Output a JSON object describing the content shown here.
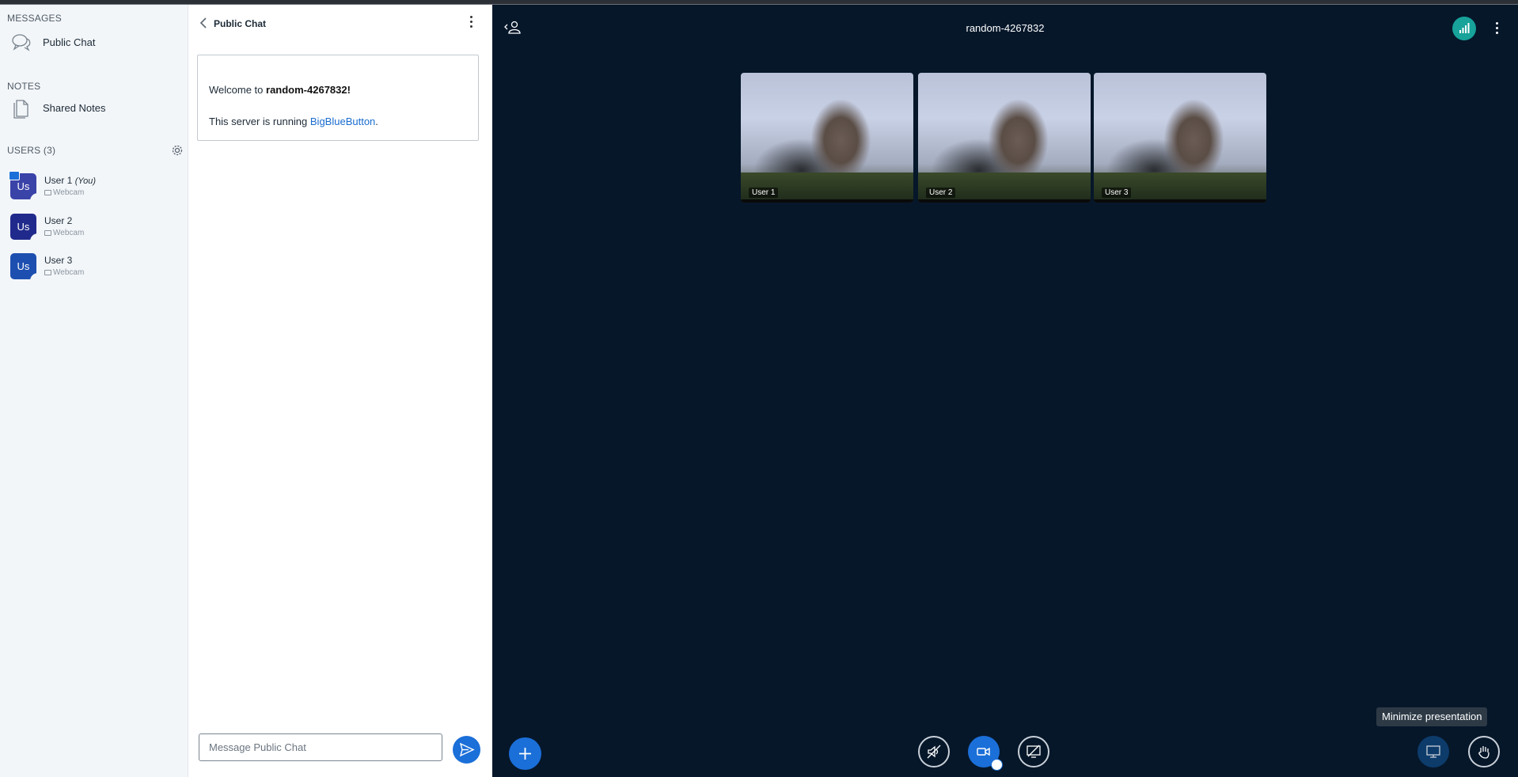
{
  "sidebar": {
    "messages_title": "MESSAGES",
    "public_chat_label": "Public Chat",
    "notes_title": "NOTES",
    "shared_notes_label": "Shared Notes",
    "users_title": "USERS (3)",
    "users": [
      {
        "initials": "Us",
        "name": "User 1",
        "you": "(You)",
        "status": "Webcam",
        "color": "#3a43a8"
      },
      {
        "initials": "Us",
        "name": "User 2",
        "you": "",
        "status": "Webcam",
        "color": "#202a8c"
      },
      {
        "initials": "Us",
        "name": "User 3",
        "you": "",
        "status": "Webcam",
        "color": "#1d4fb0"
      }
    ]
  },
  "chat": {
    "title": "Public Chat",
    "welcome_prefix": "Welcome to ",
    "room_name": "random-4267832",
    "welcome_suffix": "!",
    "server_prefix": "This server is running ",
    "server_link": "BigBlueButton",
    "server_suffix": ".",
    "input_placeholder": "Message Public Chat"
  },
  "main": {
    "meeting_title": "random-4267832",
    "videos": [
      {
        "label": "User 1"
      },
      {
        "label": "User 2"
      },
      {
        "label": "User 3"
      }
    ],
    "tooltip": "Minimize presentation"
  },
  "colors": {
    "accent": "#1b6fd8",
    "background": "#06172a",
    "connection": "#17a29a"
  }
}
